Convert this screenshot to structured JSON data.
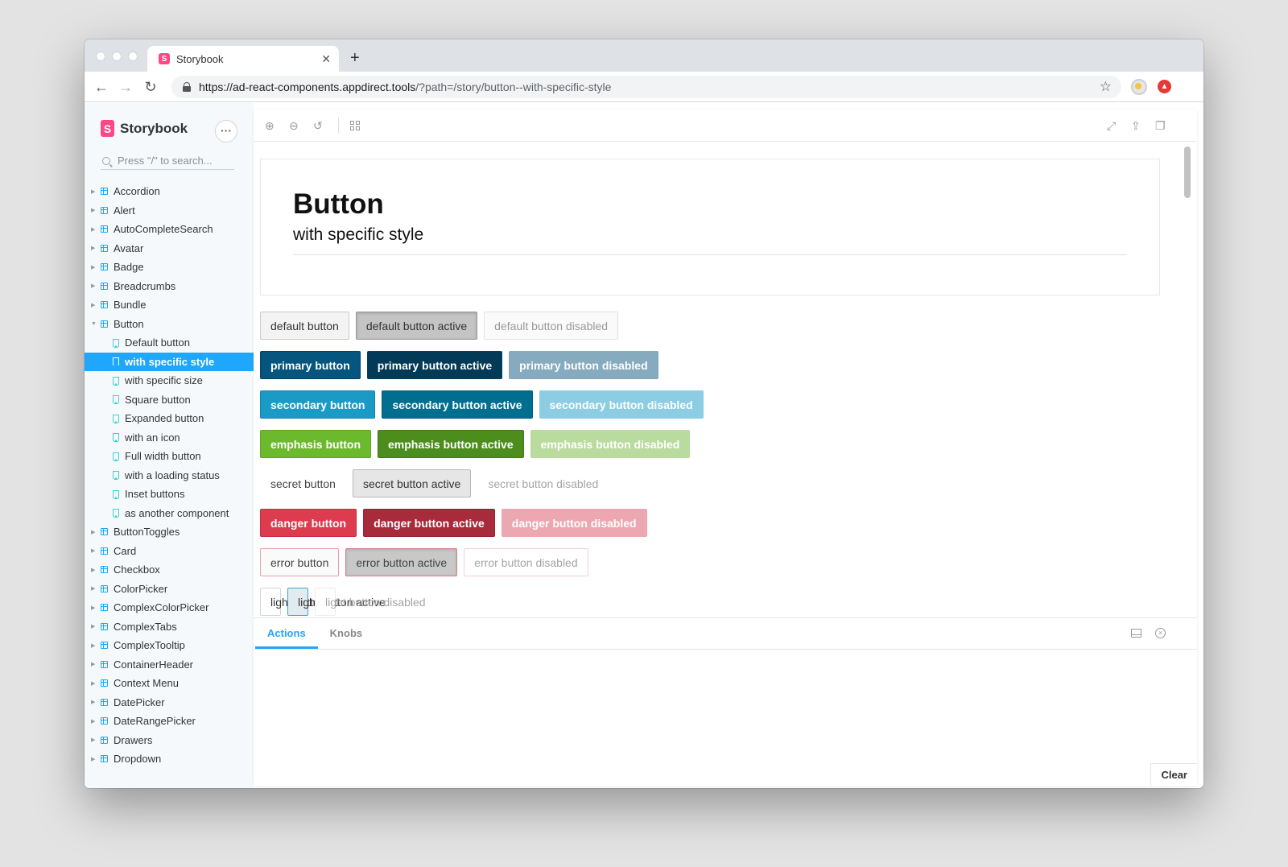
{
  "browser": {
    "tab_title": "Storybook",
    "tab_close": "✕",
    "new_tab": "+",
    "url_host": "https://ad-react-components.appdirect.tools",
    "url_path": "/?path=/story/button--with-specific-style"
  },
  "sidebar": {
    "brand": "Storybook",
    "search_placeholder": "Press \"/\" to search...",
    "items_before": [
      "Accordion",
      "Alert",
      "AutoCompleteSearch",
      "Avatar",
      "Badge",
      "Breadcrumbs",
      "Bundle"
    ],
    "expanded": "Button",
    "stories": [
      "Default button",
      "with specific style",
      "with specific size",
      "Square button",
      "Expanded button",
      "with an icon",
      "Full width button",
      "with a loading status",
      "Inset buttons",
      "as another component"
    ],
    "items_after": [
      "ButtonToggles",
      "Card",
      "Checkbox",
      "ColorPicker",
      "ComplexColorPicker",
      "ComplexTabs",
      "ComplexTooltip",
      "ContainerHeader",
      "Context Menu",
      "DatePicker",
      "DateRangePicker",
      "Drawers",
      "Dropdown"
    ]
  },
  "story": {
    "title": "Button",
    "subtitle": "with specific style"
  },
  "buttons": {
    "default": [
      "default button",
      "default button active",
      "default button disabled"
    ],
    "primary": [
      "primary button",
      "primary button active",
      "primary button disabled"
    ],
    "secondary": [
      "secondary button",
      "secondary button active",
      "secondary button disabled"
    ],
    "emphasis": [
      "emphasis button",
      "emphasis button active",
      "emphasis button disabled"
    ],
    "secret": [
      "secret button",
      "secret button active",
      "secret button disabled"
    ],
    "danger": [
      "danger button",
      "danger button active",
      "danger button disabled"
    ],
    "error": [
      "error button",
      "error button active",
      "error button disabled"
    ],
    "light": [
      "light button",
      "light button active",
      "light button disabled"
    ]
  },
  "addons": {
    "tabs": [
      "Actions",
      "Knobs"
    ],
    "clear": "Clear"
  },
  "colors": {
    "storybook_pink": "#ff4785",
    "selection_blue": "#1ea7fd"
  }
}
